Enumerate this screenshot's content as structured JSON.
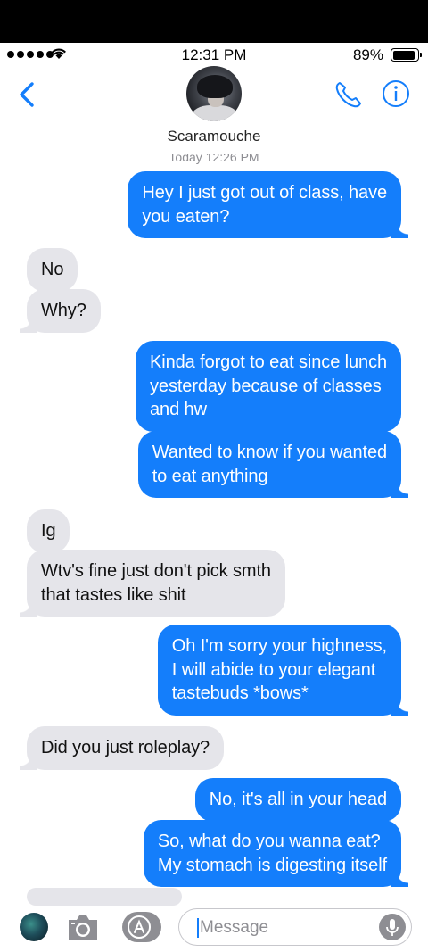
{
  "status_bar": {
    "time": "12:31 PM",
    "battery": "89%",
    "battery_level": 0.89,
    "signal_icon": "signal-dots-icon",
    "wifi_icon": "wifi-icon"
  },
  "header": {
    "contact_name": "Scaramouche",
    "back_icon": "chevron-left-icon",
    "call_icon": "phone-icon",
    "info_icon": "info-icon"
  },
  "conversation": {
    "timestamp": "Today 12:26 PM",
    "messages": [
      {
        "from": "me",
        "text": "Hey I just got out of class, have\nyou eaten?"
      },
      {
        "from": "them",
        "text": "No"
      },
      {
        "from": "them",
        "text": "Why?"
      },
      {
        "from": "me",
        "text": "Kinda forgot to eat since lunch\nyesterday because of classes\nand hw"
      },
      {
        "from": "me",
        "text": "Wanted to know if you wanted\nto eat anything"
      },
      {
        "from": "them",
        "text": "Ig"
      },
      {
        "from": "them",
        "text": "Wtv's fine just don't pick smth\nthat tastes like shit"
      },
      {
        "from": "me",
        "text": "Oh I'm sorry your highness,\nI will abide to your elegant\ntastebuds *bows*"
      },
      {
        "from": "them",
        "text": "Did you just roleplay?"
      },
      {
        "from": "me",
        "text": "No, it's all in your head"
      },
      {
        "from": "me",
        "text": "So, what do you wanna eat?\nMy stomach is digesting itself"
      }
    ]
  },
  "input_bar": {
    "placeholder": "Message",
    "camera_icon": "camera-icon",
    "apps_icon": "app-store-icon",
    "mic_icon": "microphone-icon"
  },
  "colors": {
    "outgoing_bubble": "#147efb",
    "incoming_bubble": "#e5e5ea",
    "accent": "#147efb"
  }
}
